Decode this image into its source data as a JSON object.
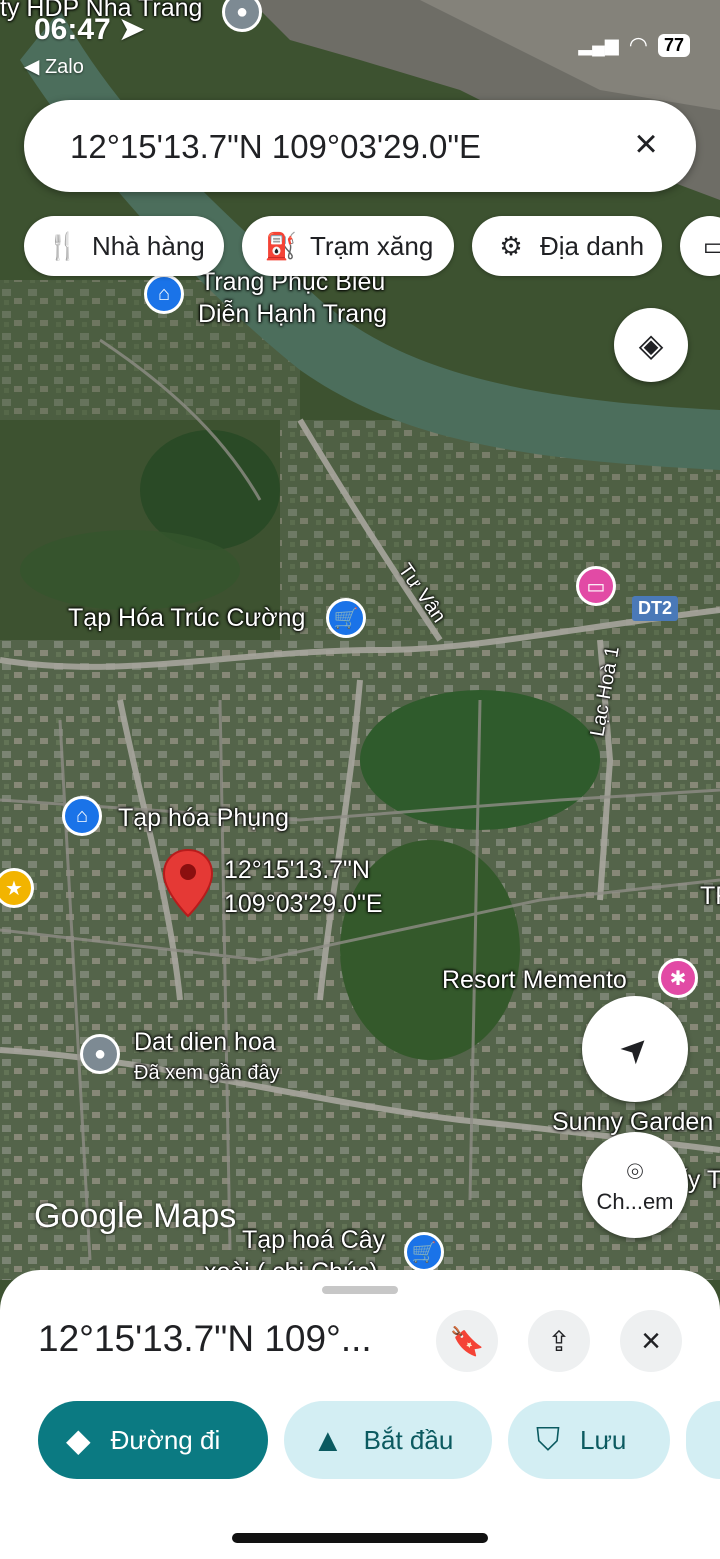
{
  "status_bar": {
    "time": "06:47",
    "back_app": "Zalo",
    "battery": "77"
  },
  "search": {
    "query": "12°15'13.7\"N 109°03'29.0\"E"
  },
  "chips": [
    {
      "label": "Nhà hàng",
      "icon": "restaurant-icon"
    },
    {
      "label": "Trạm xăng",
      "icon": "gas-station-icon"
    },
    {
      "label": "Địa danh",
      "icon": "landmark-icon"
    }
  ],
  "map": {
    "labels": {
      "top_place": "ty HDP Nha Trang",
      "trang_phuc_1": "Trang Phục Biểu",
      "trang_phuc_2": "Diễn Hạnh Trang",
      "tu_van": "Tư Vân",
      "dt2": "DT2",
      "lac_hoa": "Lạc Hoà 1",
      "truc_cuong": "Tạp Hóa Trúc Cường",
      "phung": "Tạp hóa Phụng",
      "pin_lat": "12°15'13.7\"N",
      "pin_lng": "109°03'29.0\"E",
      "memento": "Resort Memento",
      "dat_dien_hoa": "Dat dien hoa",
      "recently_viewed": "Đã xem gần đây",
      "sunny": "Sunny Garden",
      "cay_xoai_1": "Tạp hoá Cây",
      "cay_xoai_2": "xoài ( chị Chúc)",
      "right_edge": "TR",
      "near_camera": "ấy T"
    },
    "camera_label": "Ch...em",
    "logo": "Google Maps"
  },
  "sheet": {
    "title": "12°15'13.7\"N 109°...",
    "actions": [
      {
        "label": "Đường đi",
        "icon": "directions-icon"
      },
      {
        "label": "Bắt đầu",
        "icon": "navigation-arrow-icon"
      },
      {
        "label": "Lưu",
        "icon": "bookmark-icon"
      }
    ]
  },
  "colors": {
    "accent": "#0b7a82",
    "chip_light": "#d3eef3",
    "pin": "#e53935",
    "shop_blue": "#1a73e8",
    "pink": "#e24aa5"
  }
}
